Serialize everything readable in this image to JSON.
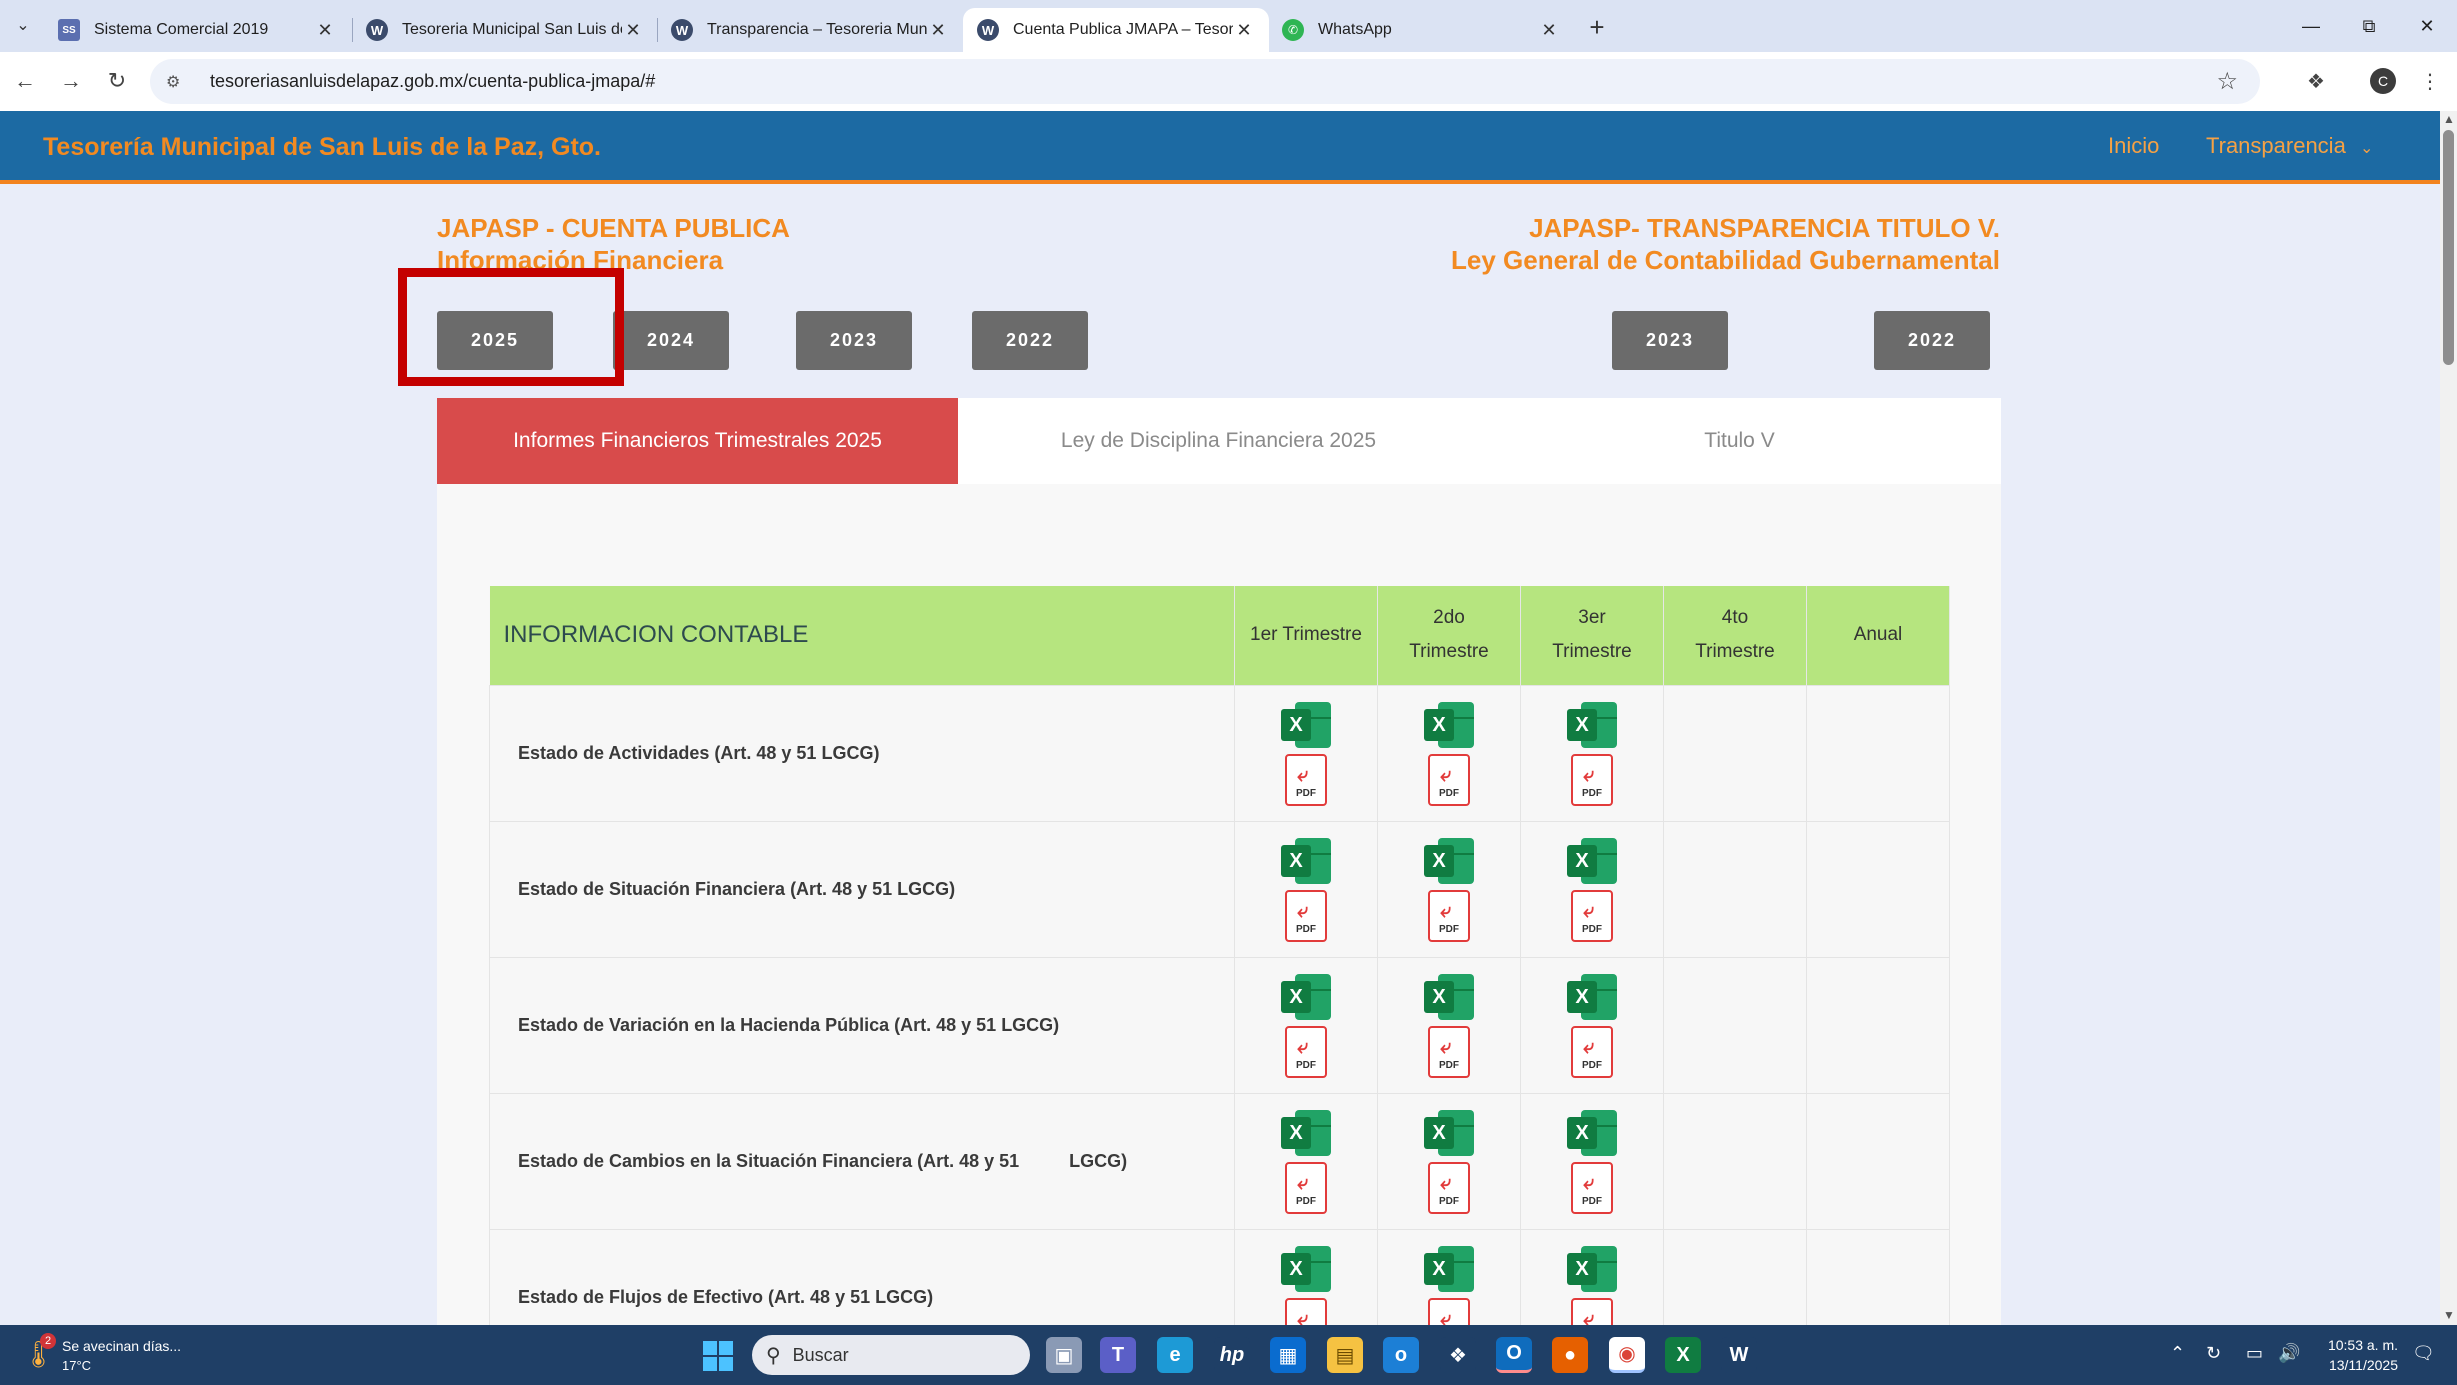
{
  "browser": {
    "tabs": [
      {
        "title": "Sistema Comercial 2019",
        "favicon": "ss"
      },
      {
        "title": "Tesoreria Municipal San Luis de",
        "favicon": "W"
      },
      {
        "title": "Transparencia – Tesoreria Munic",
        "favicon": "W"
      },
      {
        "title": "Cuenta Publica JMAPA – Tesore",
        "favicon": "W",
        "active": true
      },
      {
        "title": "WhatsApp",
        "favicon": "wa"
      }
    ],
    "url": "tesoreriasanluisdelapaz.gob.mx/cuenta-publica-jmapa/#",
    "profile_initial": "C"
  },
  "site": {
    "title": "Tesorería Municipal de San Luis de la Paz, Gto.",
    "nav": [
      "Inicio",
      "Transparencia"
    ],
    "accent_color": "#f28a21",
    "header_color": "#1c6aa3"
  },
  "page": {
    "left_heading": {
      "line1": "JAPASP - CUENTA PUBLICA",
      "line2": "Información Financiera"
    },
    "right_heading": {
      "line1": "JAPASP- TRANSPARENCIA TITULO V.",
      "line2": "Ley General de Contabilidad Gubernamental"
    },
    "years_left": [
      "2025",
      "2024",
      "2023",
      "2022"
    ],
    "years_right": [
      "2023",
      "2022"
    ],
    "tabs": [
      "Informes Financieros Trimestrales 2025",
      "Ley de Disciplina Financiera 2025",
      "Titulo V"
    ],
    "table": {
      "title": "INFORMACION CONTABLE",
      "columns": [
        {
          "line1": "1er Trimestre",
          "line2": ""
        },
        {
          "line1": "2do",
          "line2": "Trimestre"
        },
        {
          "line1": "3er",
          "line2": "Trimestre"
        },
        {
          "line1": "4to",
          "line2": "Trimestre"
        },
        {
          "line1": "Anual",
          "line2": ""
        }
      ],
      "rows": [
        {
          "label": "Estado de Actividades (Art. 48 y 51 LGCG)",
          "files": [
            true,
            true,
            true,
            false,
            false
          ]
        },
        {
          "label": "Estado de Situación Financiera (Art. 48 y 51 LGCG)",
          "files": [
            true,
            true,
            true,
            false,
            false
          ]
        },
        {
          "label": "Estado de Variación en la Hacienda Pública (Art. 48 y 51 LGCG)",
          "files": [
            true,
            true,
            true,
            false,
            false
          ]
        },
        {
          "label": "Estado de Cambios en la Situación Financiera (Art. 48 y 51          LGCG)",
          "files": [
            true,
            true,
            true,
            false,
            false
          ]
        },
        {
          "label": "Estado de Flujos de Efectivo (Art. 48 y 51 LGCG)",
          "files": [
            true,
            true,
            true,
            false,
            false
          ]
        }
      ],
      "xls_glyph": "X",
      "pdf_label": "PDF"
    }
  },
  "taskbar": {
    "weather_text": "Se avecinan días...",
    "weather_temp": "17°C",
    "weather_badge": "2",
    "search_placeholder": "Buscar",
    "time": "10:53 a. m.",
    "date": "13/11/2025"
  }
}
